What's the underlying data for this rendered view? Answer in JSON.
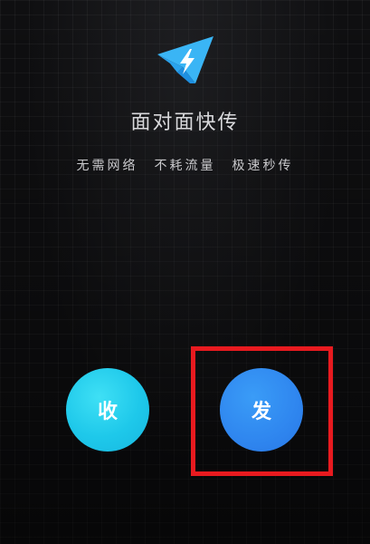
{
  "header": {
    "logo_icon": "paper-plane-lightning-icon",
    "title": "面对面快传"
  },
  "features": [
    {
      "label": "无需网络"
    },
    {
      "label": "不耗流量"
    },
    {
      "label": "极速秒传"
    }
  ],
  "actions": {
    "receive_label": "收",
    "send_label": "发"
  },
  "colors": {
    "background": "#0f0f11",
    "logo_light": "#3ab5f5",
    "logo_dark": "#1e8fe0",
    "receive": "#1ec8ea",
    "send": "#2f86ef",
    "highlight": "#e81a1f"
  }
}
